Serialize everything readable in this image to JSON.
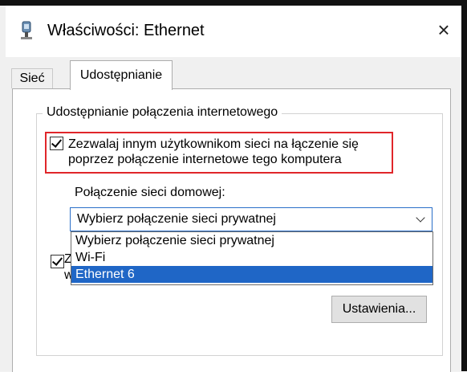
{
  "window": {
    "title": "Właściwości: Ethernet",
    "close_label": "×"
  },
  "tabs": [
    {
      "label": "Sieć",
      "active": false
    },
    {
      "label": "Udostępnianie",
      "active": true
    }
  ],
  "sharing": {
    "group_title": "Udostępnianie połączenia internetowego",
    "allow_checkbox": {
      "checked": true,
      "label": "Zezwalaj innym użytkownikom sieci na łączenie się poprzez połączenie internetowe tego komputera"
    },
    "home_network_label": "Połączenie sieci domowej:",
    "dropdown": {
      "selected": "Wybierz połączenie sieci prywatnej",
      "options": [
        "Wybierz połączenie sieci prywatnej",
        "Wi-Fi",
        "Ethernet 6"
      ],
      "highlighted_option": "Ethernet 6"
    },
    "second_checkbox": {
      "checked": true,
      "partial_label_line1": "Z",
      "partial_label_line2": "w"
    },
    "settings_button": "Ustawienia..."
  },
  "colors": {
    "highlight_border": "#e0262a",
    "selected_option": "#1f66c6",
    "dropdown_border": "#2a6fc9"
  }
}
